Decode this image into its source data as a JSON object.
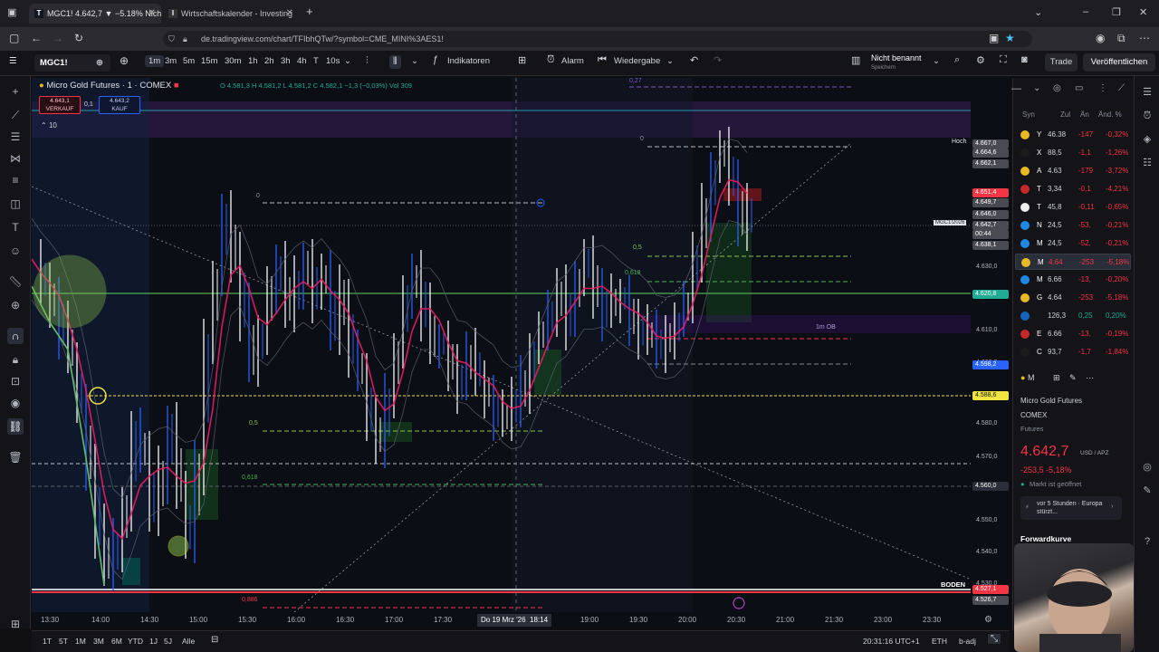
{
  "browser": {
    "tabs": [
      {
        "label": "MGC1! 4.642,7 ▼ −5.18% Nicht",
        "favicon": "TV",
        "active": true
      },
      {
        "label": "Wirtschaftskalender - Investing",
        "favicon": "IN",
        "active": false
      }
    ],
    "url": "de.tradingview.com/chart/TFIbhQTw/?symbol=CME_MINI%3AES1!"
  },
  "toolbar": {
    "symbol": "MGC1!",
    "timeframes": [
      "1m",
      "3m",
      "5m",
      "15m",
      "30m",
      "1h",
      "2h",
      "3h",
      "4h",
      "T",
      "10s"
    ],
    "selected_timeframe": "1m",
    "indicators_label": "Indikatoren",
    "alert_label": "Alarm",
    "replay_label": "Wiedergabe",
    "layout_name": "Nicht benannt",
    "layout_status": "Speichern",
    "trade_label": "Trade",
    "publish_label": "Veröffentlichen"
  },
  "legend": {
    "title": "Micro Gold Futures · 1 · COMEX",
    "ohlc": "O 4.581,3 H 4.581,2 L 4.581,2 C 4.582,1 −1,3 (−0,03%) Vol 309",
    "sell_price": "4.643,1",
    "sell_label": "VERKAUF",
    "spread": "0,1",
    "buy_price": "4.643,2",
    "buy_label": "KAUF",
    "qty": "10"
  },
  "chart": {
    "fib_labels": {
      "a": "0",
      "b": "0,5",
      "c": "0,618",
      "d": "0,886",
      "e": "0",
      "f": "0,5",
      "g": "0,618",
      "h": "0,27"
    },
    "zone_labels": {
      "ob": "1m OB",
      "high": "Hoch",
      "low": "BODEN",
      "contract": "MGC1!2026"
    },
    "crosshair_time": "Do 19 Mrz '26  18:14"
  },
  "price_scale": {
    "ticks": [
      "4.630,0",
      "4.610,0",
      "4.600,0",
      "4.580,0",
      "4.570,0",
      "4.550,0",
      "4.540,0",
      "4.530,0"
    ],
    "labels": [
      {
        "text": "4.667,0",
        "color": "#4a4a52"
      },
      {
        "text": "4.664,6",
        "color": "#4a4a52"
      },
      {
        "text": "4.662,1",
        "color": "#4a4a52"
      },
      {
        "text": "4.651,4",
        "color": "#f23645"
      },
      {
        "text": "4.649,7",
        "color": "#4a4a52"
      },
      {
        "text": "4.646,0",
        "color": "#4a4a52"
      },
      {
        "text": "4.642,7",
        "color": "#4a4a52"
      },
      {
        "text": "00:44",
        "color": "#4a4a52"
      },
      {
        "text": "4.638,1",
        "color": "#4a4a52"
      },
      {
        "text": "4.620,8",
        "color": "#22ab94"
      },
      {
        "text": "4.598,2",
        "color": "#2962ff"
      },
      {
        "text": "4.588,6",
        "color": "#f0e442"
      },
      {
        "text": "4.560,0",
        "color": "#2a2e39"
      },
      {
        "text": "4.527,1",
        "color": "#f23645"
      },
      {
        "text": "4.526,7",
        "color": "#4a4a52"
      }
    ]
  },
  "time_axis": [
    "13:30",
    "14:00",
    "14:30",
    "15:00",
    "15:30",
    "16:00",
    "16:30",
    "17:00",
    "17:30",
    "19:00",
    "19:30",
    "20:00",
    "20:30",
    "21:00",
    "21:30",
    "23:00",
    "23:30"
  ],
  "bottom_bar": {
    "ranges": [
      "1T",
      "5T",
      "1M",
      "3M",
      "6M",
      "YTD",
      "1J",
      "5J",
      "Alle"
    ],
    "clock": "20:31:16 UTC+1",
    "session": "ETH",
    "adj": "b-adj"
  },
  "watchlist": {
    "headers": [
      "Syn",
      "Zul",
      "Än",
      "Änd. %"
    ],
    "rows": [
      {
        "sym": "Y",
        "last": "46.38",
        "chg": "-147",
        "pct": "-0,32%",
        "icon_color": "#e8b923",
        "trend": "neg"
      },
      {
        "sym": "X",
        "last": "88,5",
        "chg": "-1,1",
        "pct": "-1,26%",
        "icon_color": "#1c1c1c",
        "trend": "neg"
      },
      {
        "sym": "A",
        "last": "4.63",
        "chg": "-179",
        "pct": "-3,72%",
        "icon_color": "#e8b923",
        "trend": "neg"
      },
      {
        "sym": "T",
        "last": "3,34",
        "chg": "-0,1",
        "pct": "-4,21%",
        "icon_color": "#c62828",
        "trend": "neg"
      },
      {
        "sym": "T",
        "last": "45,8",
        "chg": "-0,11",
        "pct": "-0,65%",
        "icon_color": "#eeeeee",
        "trend": "neg"
      },
      {
        "sym": "N",
        "last": "24,5",
        "chg": "-53,",
        "pct": "-0,21%",
        "icon_color": "#1e88e5",
        "trend": "neg"
      },
      {
        "sym": "M",
        "last": "24,5",
        "chg": "-52,",
        "pct": "-0,21%",
        "icon_color": "#1e88e5",
        "trend": "neg"
      },
      {
        "sym": "M",
        "last": "4.64",
        "chg": "-253",
        "pct": "-5,18%",
        "icon_color": "#e8b923",
        "trend": "neg"
      },
      {
        "sym": "M",
        "last": "6.66",
        "chg": "-13,",
        "pct": "-0,20%",
        "icon_color": "#1e88e5",
        "trend": "neg"
      },
      {
        "sym": "G",
        "last": "4.64",
        "chg": "-253",
        "pct": "-5,18%",
        "icon_color": "#e8b923",
        "trend": "neg"
      },
      {
        "sym": "",
        "last": "126,3",
        "chg": "0,25",
        "pct": "0,20%",
        "icon_color": "#1565c0",
        "trend": "pos"
      },
      {
        "sym": "E",
        "last": "6.66",
        "chg": "-13,",
        "pct": "-0,19%",
        "icon_color": "#c62828",
        "trend": "neg"
      },
      {
        "sym": "C",
        "last": "93,7",
        "chg": "-1,7",
        "pct": "-1,84%",
        "icon_color": "#1c1c1c",
        "trend": "neg"
      }
    ]
  },
  "detail": {
    "name": "Micro Gold Futures",
    "exchange": "COMEX",
    "type": "Futures",
    "price": "4.642,7",
    "currency": "USD / APZ",
    "change": "-253,5  -5,18%",
    "status": "Markt ist geöffnet",
    "news": "vor 5 Stunden · Europa stürzt...",
    "forward_curve": "Forwardkurve"
  },
  "colors": {
    "bull": "#ffffff",
    "bear": "#2962ff",
    "ma": "#e91e63",
    "green_line": "#4caf50",
    "yellow_line": "#f0e442"
  }
}
